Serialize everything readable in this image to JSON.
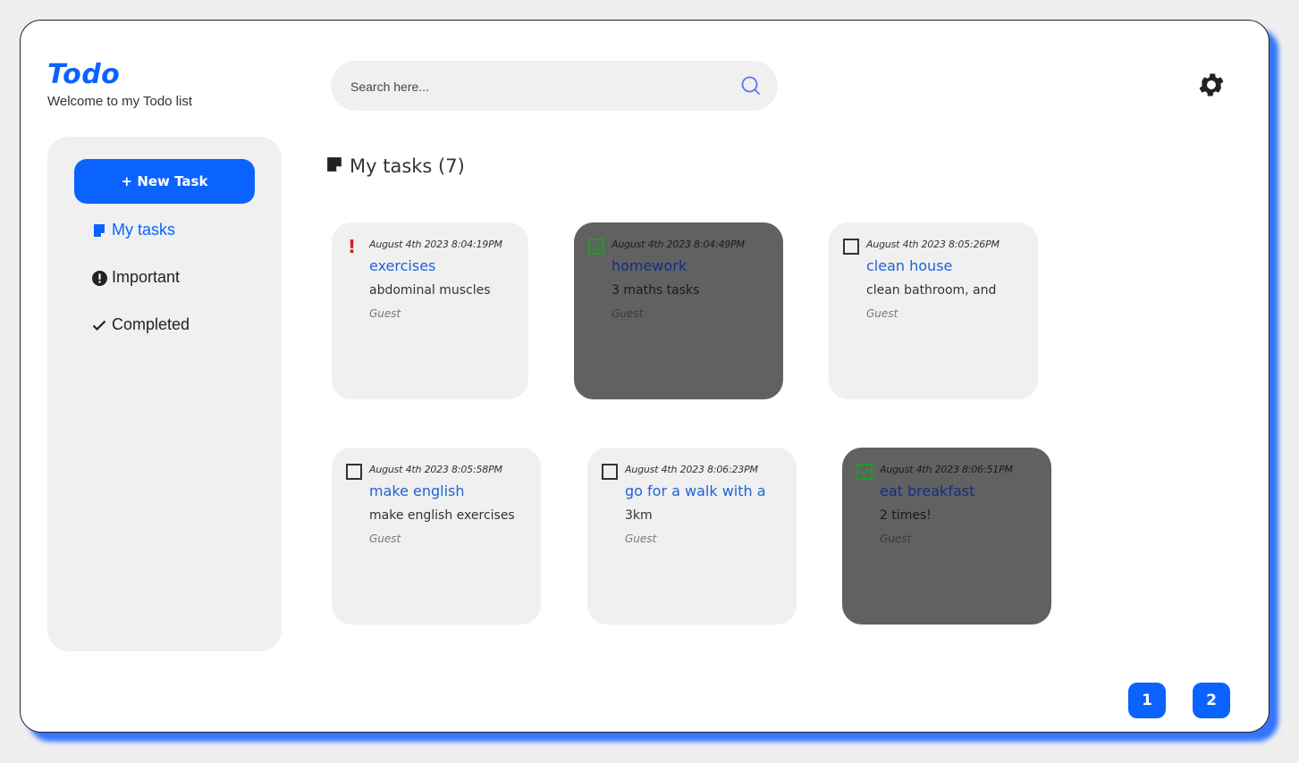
{
  "brand": {
    "logo": "Todo",
    "subtitle": "Welcome to my Todo list"
  },
  "search": {
    "placeholder": "Search here..."
  },
  "sidebar": {
    "new_task_label": "+ New Task",
    "items": [
      {
        "label": "My tasks",
        "icon": "note-icon",
        "active": true
      },
      {
        "label": "Important",
        "icon": "exclamation-circle-icon",
        "active": false
      },
      {
        "label": "Completed",
        "icon": "check-icon",
        "active": false
      }
    ]
  },
  "main": {
    "section_title": "My tasks (7)"
  },
  "tasks": [
    {
      "date": "August 4th 2023 8:04:19PM",
      "title": "exercises",
      "description": "abdominal muscles",
      "owner": "Guest",
      "marker": "important"
    },
    {
      "date": "August 4th 2023 8:04:49PM",
      "title": "homework",
      "description": "3 maths tasks",
      "owner": "Guest",
      "marker": "checked"
    },
    {
      "date": "August 4th 2023 8:05:26PM",
      "title": "clean house",
      "description": "clean bathroom, and",
      "owner": "Guest",
      "marker": "unchecked"
    },
    {
      "date": "August 4th 2023 8:05:58PM",
      "title": "make english",
      "description": "make english exercises",
      "owner": "Guest",
      "marker": "unchecked"
    },
    {
      "date": "August 4th 2023 8:06:23PM",
      "title": "go for a walk with a",
      "description": "3km",
      "owner": "Guest",
      "marker": "unchecked"
    },
    {
      "date": "August 4th 2023 8:06:51PM",
      "title": "eat breakfast",
      "description": "2 times!",
      "owner": "Guest",
      "marker": "checked"
    }
  ],
  "pagination": {
    "pages": [
      "1",
      "2"
    ]
  },
  "colors": {
    "accent": "#0b63ff",
    "card_bg": "#f0f0f0",
    "done_bg": "#616161",
    "important": "#d62020",
    "check_green": "#1f9b2c",
    "shadow": "#286eff"
  }
}
